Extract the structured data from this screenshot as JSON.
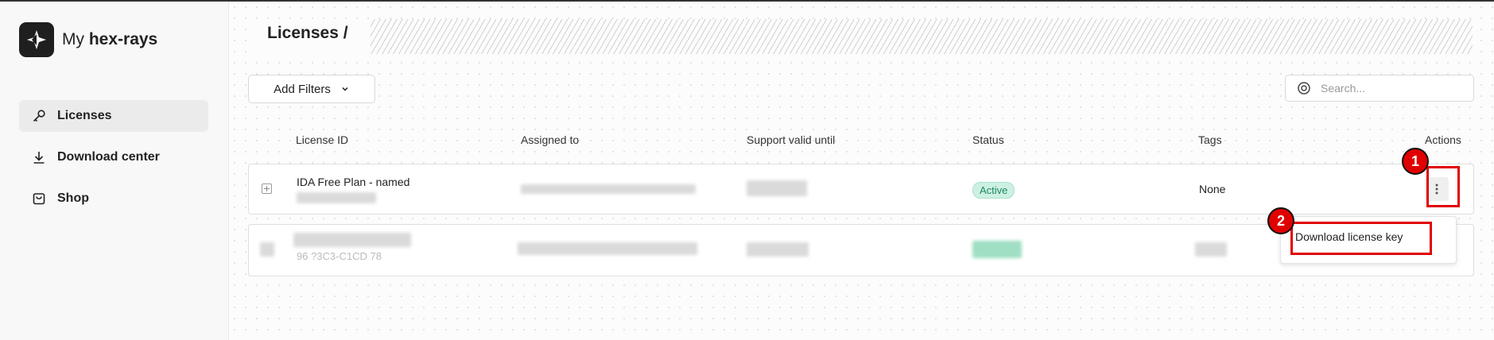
{
  "app": {
    "logo_prefix": "My",
    "logo_brand": "hex-rays"
  },
  "sidebar": {
    "items": [
      {
        "label": "Licenses",
        "icon": "key-icon",
        "active": true
      },
      {
        "label": "Download center",
        "icon": "download-icon",
        "active": false
      },
      {
        "label": "Shop",
        "icon": "shop-bag-icon",
        "active": false
      }
    ]
  },
  "header": {
    "title": "Licenses /"
  },
  "toolbar": {
    "filter_label": "Add Filters",
    "search_placeholder": "Search..."
  },
  "table": {
    "columns": [
      "License ID",
      "Assigned to",
      "Support valid until",
      "Status",
      "Tags",
      "Actions"
    ],
    "rows": [
      {
        "license_id": "IDA Free Plan - named",
        "status": "Active",
        "tags": "None"
      },
      {
        "partial_text": "96 ?3C3-C1CD 78"
      }
    ]
  },
  "actions_menu": {
    "items": [
      "Download license key"
    ]
  },
  "annotations": [
    {
      "number": "1",
      "color": "#e00000"
    },
    {
      "number": "2",
      "color": "#e00000"
    }
  ],
  "colors": {
    "status_active_bg": "#cdf0e2",
    "status_active_text": "#1d8a5e",
    "annotation": "#e00000"
  }
}
